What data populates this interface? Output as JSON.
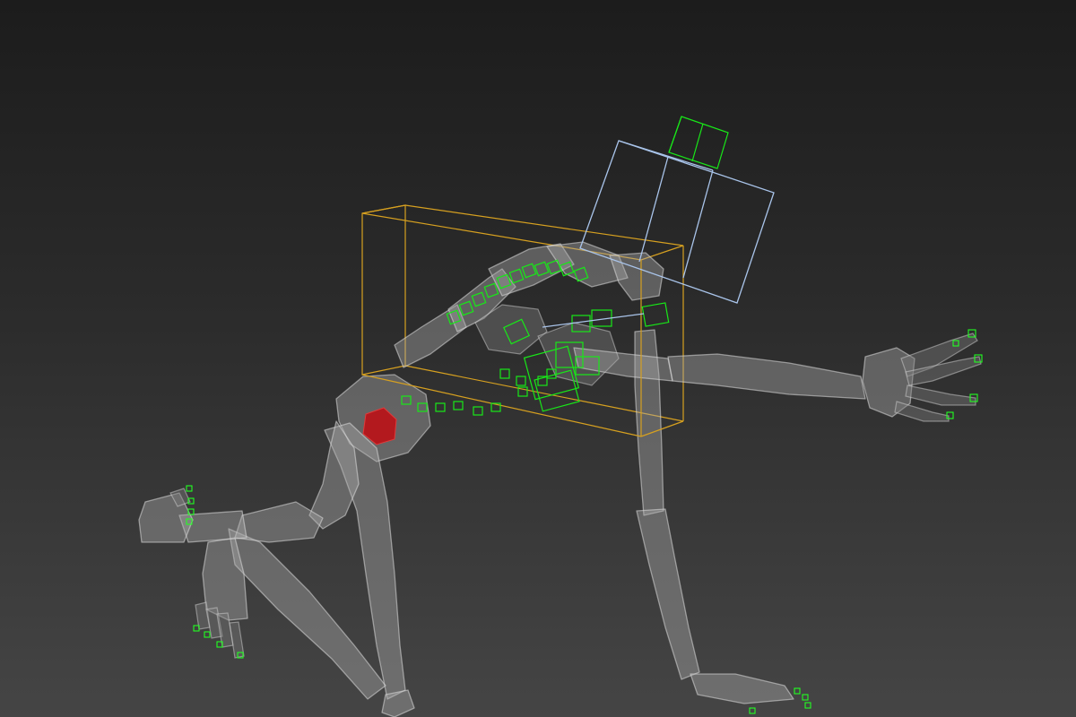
{
  "viewport": {
    "background_top": "#1c1c1c",
    "background_bottom": "#454545"
  },
  "colors": {
    "bone_fill": "#aaaaaa",
    "controller_green": "#18e818",
    "selection_bbox": "#d6a020",
    "head_box": "#a9c4ea",
    "pelvis_red": "#b3191e"
  }
}
